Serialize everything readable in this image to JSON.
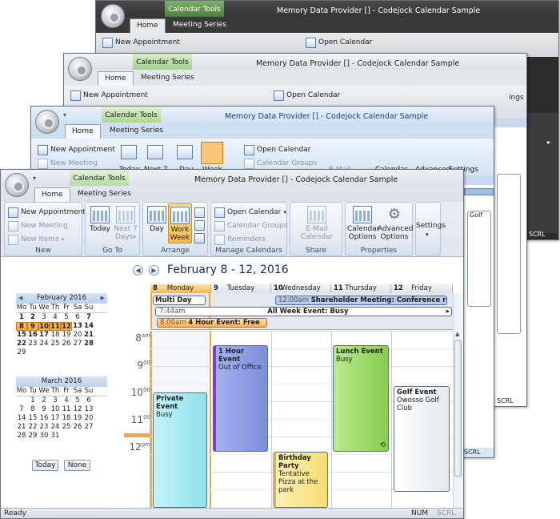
{
  "windows": {
    "w1": {
      "title": "Memory Data Provider [] - Codejock Calendar Sample",
      "context_tab": "Calendar Tools",
      "tabs": [
        "Home",
        "Meeting Series"
      ],
      "new_appointment": "New Appointment",
      "open_calendar": "Open Calendar",
      "status_right": "SCRL"
    },
    "w2": {
      "title": "Memory Data Provider [] - Codejock Calendar Sample",
      "context_tab": "Calendar Tools",
      "tabs": [
        "Home",
        "Meeting Series"
      ],
      "new_appointment": "New Appointment",
      "open_calendar": "Open Calendar",
      "settings": "ings",
      "status_right": "SCRL"
    },
    "w3": {
      "title": "Memory Data Provider [] - Codejock Calendar Sample",
      "context_tab": "Calendar Tools",
      "tabs": [
        "Home",
        "Meeting Series"
      ],
      "new_appointment": "New Appointment",
      "new_meeting": "New Meeting",
      "open_calendar": "Open Calendar",
      "calendar_groups": "Calendar Groups",
      "today": "Today",
      "next7": "Next 7",
      "day": "Day",
      "week": "Week",
      "email": "E-Mail",
      "calendar": "Calendar",
      "advanced": "Advanced",
      "settings": "Settings",
      "golf": "Golf",
      "status_right": "SCRL"
    }
  },
  "main": {
    "title": "Memory Data Provider [] - Codejock Calendar Sample",
    "context_tab": "Calendar Tools",
    "tabs": {
      "home": "Home",
      "meeting_series": "Meeting Series"
    },
    "ribbon": {
      "new": {
        "new_appointment": "New Appointment",
        "new_meeting": "New Meeting",
        "new_items": "New Items",
        "label": "New"
      },
      "goto": {
        "today": "Today",
        "next7_line1": "Next 7",
        "next7_line2": "Days",
        "label": "Go To"
      },
      "arrange": {
        "day": "Day",
        "work_week_line1": "Work",
        "work_week_line2": "Week",
        "label": "Arrange"
      },
      "manage": {
        "open_calendar": "Open Calendar",
        "calendar_groups": "Calendar Groups",
        "reminders": "Reminders",
        "label": "Manage Calendars"
      },
      "share": {
        "email_line1": "E-Mail",
        "email_line2": "Calendar",
        "label": "Share"
      },
      "properties": {
        "options_line1": "Calendar",
        "options_line2": "Options",
        "advanced_line1": "Advanced",
        "advanced_line2": "Options",
        "label": "Properties"
      },
      "settings": "Settings"
    },
    "date_range": "February 8 - 12, 2016",
    "days": [
      {
        "num": "8",
        "name": "Monday"
      },
      {
        "num": "9",
        "name": "Tuesday"
      },
      {
        "num": "10",
        "name": "Wednesday"
      },
      {
        "num": "11",
        "name": "Thursday"
      },
      {
        "num": "12",
        "name": "Friday"
      }
    ],
    "allday": {
      "multi_day": "Multi Day Event",
      "shareholder_time": "12:00am",
      "shareholder": "Shareholder Meeting: Conference roo",
      "all_week_time": "7:44am",
      "all_week": "All Week Event: Busy",
      "four_hour_time": "8:00am",
      "four_hour": "4 Hour Event: Free"
    },
    "hours": [
      {
        "h": "8",
        "ap": "am"
      },
      {
        "h": "9",
        "ap": "00"
      },
      {
        "h": "10",
        "ap": "00"
      },
      {
        "h": "11",
        "ap": "00"
      },
      {
        "h": "12",
        "ap": "pm"
      }
    ],
    "events": {
      "one_hour": {
        "title": "1 Hour Event",
        "body": "Out of Office"
      },
      "lunch": {
        "title": "Lunch Event",
        "body": "Busy"
      },
      "private": {
        "title": "Private Event",
        "body": "Busy"
      },
      "golf": {
        "title": "Golf Event",
        "body": "Owosso Golf Club"
      },
      "birthday": {
        "title": "Birthday Party",
        "body1": "Tentative",
        "body2": "Pizza at the park"
      }
    },
    "mini_feb": {
      "title": "February 2016",
      "dows": [
        "Mo",
        "Tu",
        "We",
        "Th",
        "Fr",
        "Sa",
        "Su"
      ],
      "rows": [
        [
          "1",
          "2",
          "3",
          "4",
          "5",
          "6",
          "7"
        ],
        [
          "8",
          "9",
          "10",
          "11",
          "12",
          "13",
          "14"
        ],
        [
          "15",
          "16",
          "17",
          "18",
          "19",
          "20",
          "21"
        ],
        [
          "22",
          "23",
          "24",
          "25",
          "26",
          "27",
          "28"
        ],
        [
          "29",
          "",
          "",
          "",
          "",
          "",
          ""
        ]
      ]
    },
    "mini_mar": {
      "title": "March 2016",
      "dows": [
        "Mo",
        "Tu",
        "We",
        "Th",
        "Fr",
        "Sa",
        "Su"
      ],
      "rows": [
        [
          "",
          "1",
          "2",
          "3",
          "4",
          "5",
          "6"
        ],
        [
          "7",
          "8",
          "9",
          "10",
          "11",
          "12",
          "13"
        ],
        [
          "14",
          "15",
          "16",
          "17",
          "18",
          "19",
          "20"
        ],
        [
          "21",
          "22",
          "23",
          "24",
          "25",
          "26",
          "27"
        ],
        [
          "28",
          "29",
          "30",
          "31",
          "",
          "",
          ""
        ]
      ]
    },
    "today_btn": "Today",
    "none_btn": "None",
    "status_left": "Ready",
    "status_num": "NUM",
    "status_scrl": "SCRL"
  },
  "colors": {
    "accent_orange": "#f3b559",
    "event_blue": "#8e9de4",
    "event_green": "#9ddb6a",
    "event_cyan": "#a9ecf1",
    "event_yellow": "#fbe68a"
  }
}
